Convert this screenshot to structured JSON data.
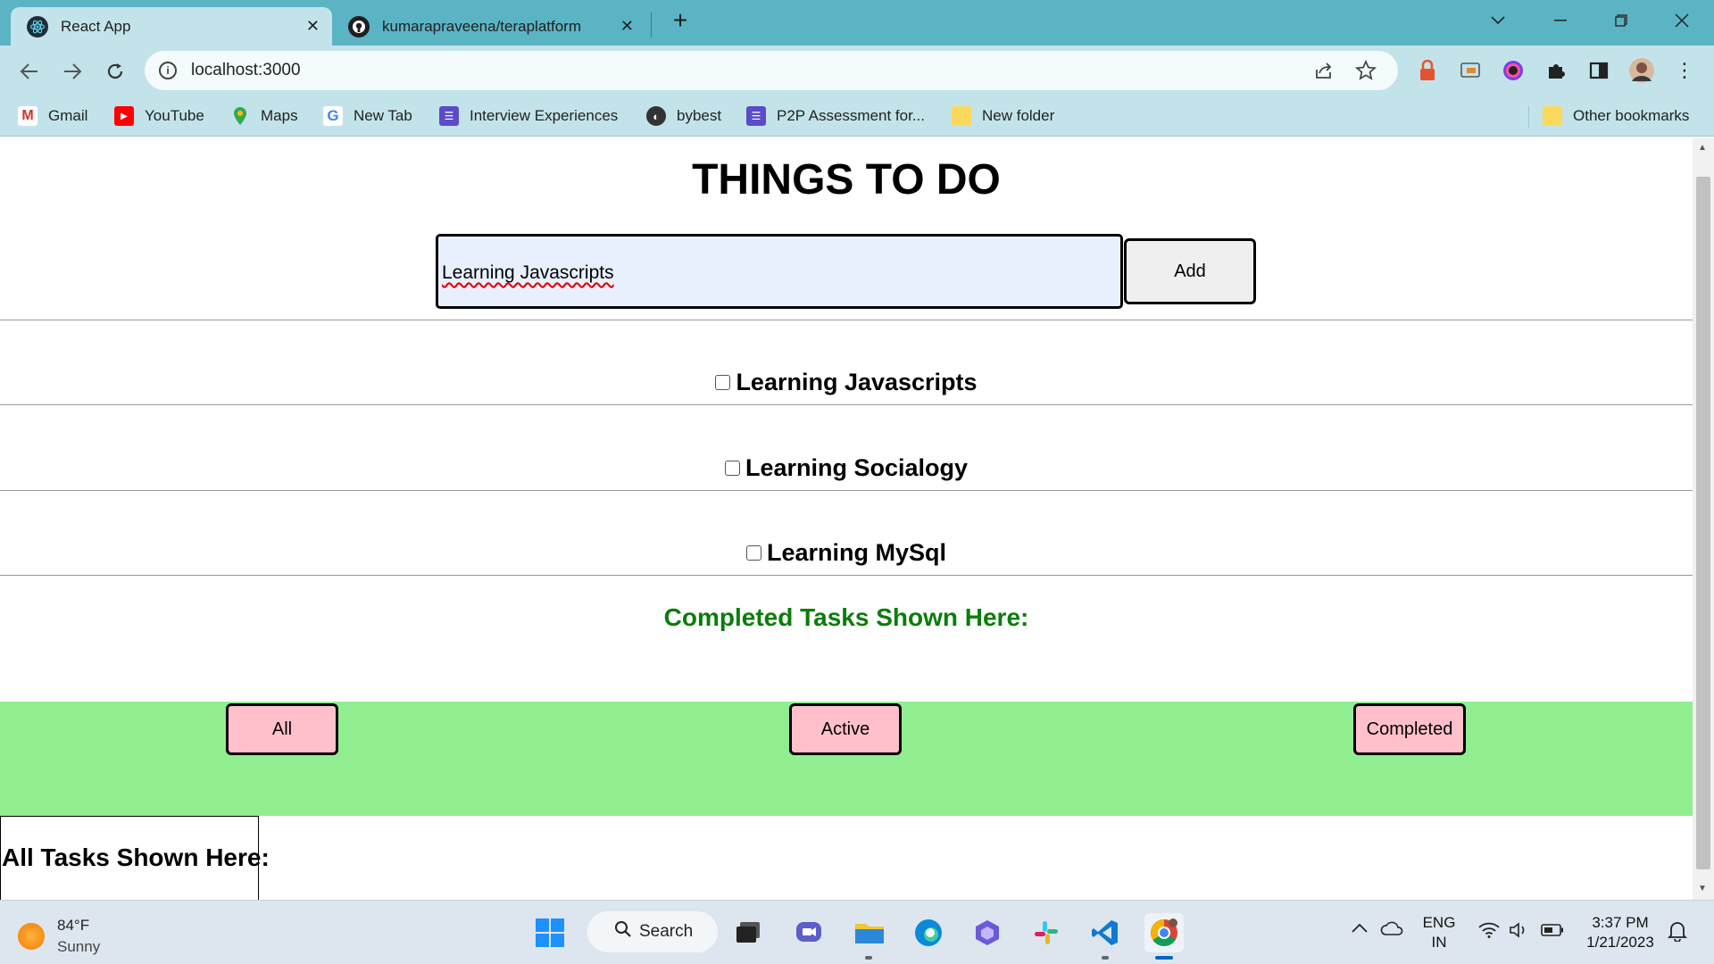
{
  "browser": {
    "tabs": [
      {
        "title": "React App",
        "icon": "react-icon",
        "active": true
      },
      {
        "title": "kumarapraveena/teraplatform",
        "icon": "github-icon",
        "active": false
      }
    ],
    "new_tab": "+",
    "close": "✕",
    "address": "localhost:3000",
    "bookmarks": [
      {
        "label": "Gmail",
        "icon": "gmail-icon"
      },
      {
        "label": "YouTube",
        "icon": "youtube-icon"
      },
      {
        "label": "Maps",
        "icon": "maps-icon"
      },
      {
        "label": "New Tab",
        "icon": "google-icon"
      },
      {
        "label": "Interview Experiences",
        "icon": "list-icon"
      },
      {
        "label": "bybest",
        "icon": "globe-icon"
      },
      {
        "label": "P2P Assessment for...",
        "icon": "list-icon"
      },
      {
        "label": "New folder",
        "icon": "folder-icon"
      },
      {
        "label": "Other bookmarks",
        "icon": "folder-icon"
      }
    ]
  },
  "app": {
    "title": "THINGS TO DO",
    "input_value": "Learning Javascripts",
    "add_label": "Add",
    "todos": [
      {
        "text": "Learning Javascripts",
        "done": false
      },
      {
        "text": "Learning Socialogy",
        "done": false
      },
      {
        "text": "Learning MySql",
        "done": false
      }
    ],
    "completed_heading": "Completed Tasks Shown Here:",
    "filters": [
      "All",
      "Active",
      "Completed"
    ],
    "all_tasks_heading": "All Tasks Shown Here:"
  },
  "taskbar": {
    "weather_temp": "84°F",
    "weather_desc": "Sunny",
    "search_label": "Search",
    "lang_top": "ENG",
    "lang_bottom": "IN",
    "time": "3:37 PM",
    "date": "1/21/2023"
  },
  "colors": {
    "tabstrip": "#5bb4c4",
    "toolbar": "#c3e3ea",
    "filter_bar": "#90ee90",
    "filter_button": "#ffc0cb",
    "completed_heading": "#0a7d0a"
  }
}
